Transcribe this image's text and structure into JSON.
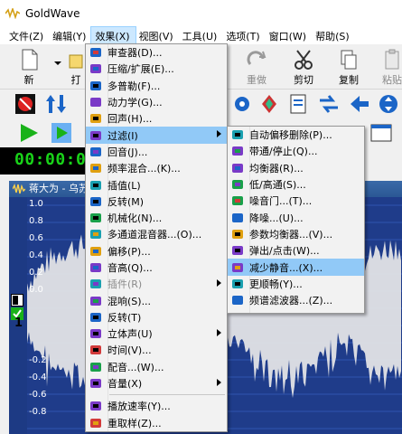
{
  "app": {
    "title": "GoldWave"
  },
  "menubar": [
    {
      "label": "文件(Z)"
    },
    {
      "label": "编辑(Y)"
    },
    {
      "label": "效果(X)"
    },
    {
      "label": "视图(V)"
    },
    {
      "label": "工具(U)"
    },
    {
      "label": "选项(T)"
    },
    {
      "label": "窗口(W)"
    },
    {
      "label": "帮助(S)"
    }
  ],
  "toolbar": {
    "new_label": "新",
    "open_label": "打",
    "redo_label": "重做",
    "cut_label": "剪切",
    "copy_label": "复制",
    "paste_label": "粘贴"
  },
  "time_display": "00:00:00",
  "wave_window": {
    "title": "蒋大为 - 乌苏",
    "y_ticks": [
      "1.0",
      "0.8",
      "0.6",
      "0.4",
      "0.2",
      "0.0",
      "-0.2",
      "-0.4",
      "-0.6",
      "-0.8"
    ],
    "track_number": "1"
  },
  "effects_menu": {
    "items": [
      {
        "label": "审查器(D)...",
        "icon": "censor-icon"
      },
      {
        "label": "压缩/扩展(E)...",
        "icon": "compress-icon"
      },
      {
        "label": "多普勒(F)...",
        "icon": "doppler-icon"
      },
      {
        "label": "动力学(G)...",
        "icon": "dynamics-icon"
      },
      {
        "label": "回声(H)...",
        "icon": "echo-icon"
      },
      {
        "label": "过滤(I)",
        "icon": "filter-icon",
        "submenu": true,
        "highlighted": true
      },
      {
        "label": "回音(J)...",
        "icon": "reverb-icon"
      },
      {
        "label": "频率混合...(K)...",
        "icon": "flanger-icon"
      },
      {
        "label": "插值(L)",
        "icon": "interpolate-icon"
      },
      {
        "label": "反转(M)",
        "icon": "invert-icon"
      },
      {
        "label": "机械化(N)...",
        "icon": "mechanize-icon"
      },
      {
        "label": "多通道混音器...(O)...",
        "icon": "mixer-icon"
      },
      {
        "label": "偏移(P)...",
        "icon": "offset-icon"
      },
      {
        "label": "音高(Q)...",
        "icon": "pitch-icon"
      },
      {
        "label": "插件(R)",
        "icon": "plugin-icon",
        "submenu": true,
        "disabled": true
      },
      {
        "label": "混响(S)...",
        "icon": "reverb2-icon"
      },
      {
        "label": "反转(T)",
        "icon": "reverse-icon"
      },
      {
        "label": "立体声(U)",
        "icon": "stereo-icon",
        "submenu": true
      },
      {
        "label": "时间(V)...",
        "icon": "time-icon"
      },
      {
        "label": "配音...(W)...",
        "icon": "voiceover-icon"
      },
      {
        "label": "音量(X)",
        "icon": "volume-icon",
        "submenu": true
      },
      {
        "label": "播放速率(Y)...",
        "icon": "playback-rate-icon",
        "separator_before": true
      },
      {
        "label": "重取样(Z)...",
        "icon": "resample-icon"
      }
    ]
  },
  "filter_submenu": {
    "items": [
      {
        "label": "自动偏移删除(P)...",
        "icon": "auto-offset-icon"
      },
      {
        "label": "带通/停止(Q)...",
        "icon": "bandpass-icon"
      },
      {
        "label": "均衡器(R)...",
        "icon": "equalizer-icon"
      },
      {
        "label": "低/高通(S)...",
        "icon": "lowhigh-icon"
      },
      {
        "label": "噪音门...(T)...",
        "icon": "noise-gate-icon"
      },
      {
        "label": "降噪...(U)...",
        "icon": "noise-reduction-icon"
      },
      {
        "label": "参数均衡器...(V)...",
        "icon": "parametric-eq-icon"
      },
      {
        "label": "弹出/点击(W)...",
        "icon": "pop-click-icon"
      },
      {
        "label": "减少静音...(X)...",
        "icon": "reduce-silence-icon",
        "highlighted": true
      },
      {
        "label": "更顺畅(Y)...",
        "icon": "smoother-icon"
      },
      {
        "label": "频谱滤波器...(Z)...",
        "icon": "spectrum-filter-icon"
      }
    ]
  }
}
